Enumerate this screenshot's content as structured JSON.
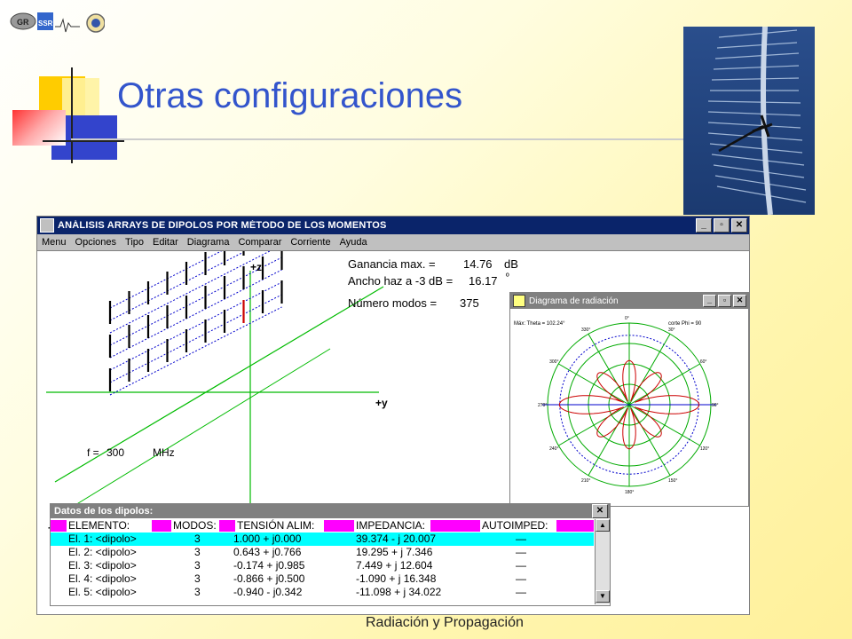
{
  "slide": {
    "title": "Otras configuraciones",
    "footer": "Radiación y Propagación",
    "logo_text_1": "GR",
    "logo_text_2": "SSR"
  },
  "app": {
    "title": "ANÁLISIS ARRAYS DE DIPOLOS POR MÉTODO DE LOS MOMENTOS",
    "window_buttons": {
      "minimize": "_",
      "maximize": "▫",
      "close": "✕"
    },
    "menu": [
      "Menu",
      "Opciones",
      "Tipo",
      "Editar",
      "Diagrama",
      "Comparar",
      "Corriente",
      "Ayuda"
    ]
  },
  "plot3d": {
    "axis_z": "+z",
    "axis_y": "+y",
    "axis_x": "+x",
    "freq_label": "f =",
    "freq_value": "300",
    "freq_unit": "MHz"
  },
  "results": {
    "gain_label": "Ganancia max. =",
    "gain_value": "14.76",
    "gain_unit": "dB",
    "beam_label": "Ancho haz a -3  dB =",
    "beam_value": "16.17",
    "beam_unit": "º",
    "modes_label": "Número modos =",
    "modes_value": "375"
  },
  "radiation_window": {
    "title": "Diagrama de radiación",
    "max_label": "Máx: Theta = 102.24°",
    "cut_label": "corte Phi = 90",
    "angle_labels": [
      "0°",
      "30°",
      "60°",
      "90°",
      "120°",
      "150°",
      "180°",
      "210°",
      "240°",
      "270°",
      "300°",
      "330°"
    ],
    "colors": {
      "pattern": "#cc0000",
      "grid": "#00aa00",
      "ref": "#0000cc"
    }
  },
  "data_window": {
    "title": "Datos de los dipolos:",
    "close": "✕",
    "columns": [
      "ELEMENTO:",
      "MODOS:",
      "TENSIÓN ALIM:",
      "IMPEDANCIA:",
      "AUTOIMPED:"
    ],
    "rows": [
      {
        "el": "El. 1: <dipolo>",
        "modos": "3",
        "tension": "1.000 + j0.000",
        "imp": "39.374 - j 20.007",
        "auto": "—"
      },
      {
        "el": "El. 2: <dipolo>",
        "modos": "3",
        "tension": "0.643 + j0.766",
        "imp": "19.295 + j 7.346",
        "auto": "—"
      },
      {
        "el": "El. 3: <dipolo>",
        "modos": "3",
        "tension": "-0.174 + j0.985",
        "imp": "7.449 + j 12.604",
        "auto": "—"
      },
      {
        "el": "El. 4: <dipolo>",
        "modos": "3",
        "tension": "-0.866 + j0.500",
        "imp": "-1.090 + j 16.348",
        "auto": "—"
      },
      {
        "el": "El. 5: <dipolo>",
        "modos": "3",
        "tension": "-0.940 - j0.342",
        "imp": "-11.098 + j 34.022",
        "auto": "—"
      }
    ]
  }
}
